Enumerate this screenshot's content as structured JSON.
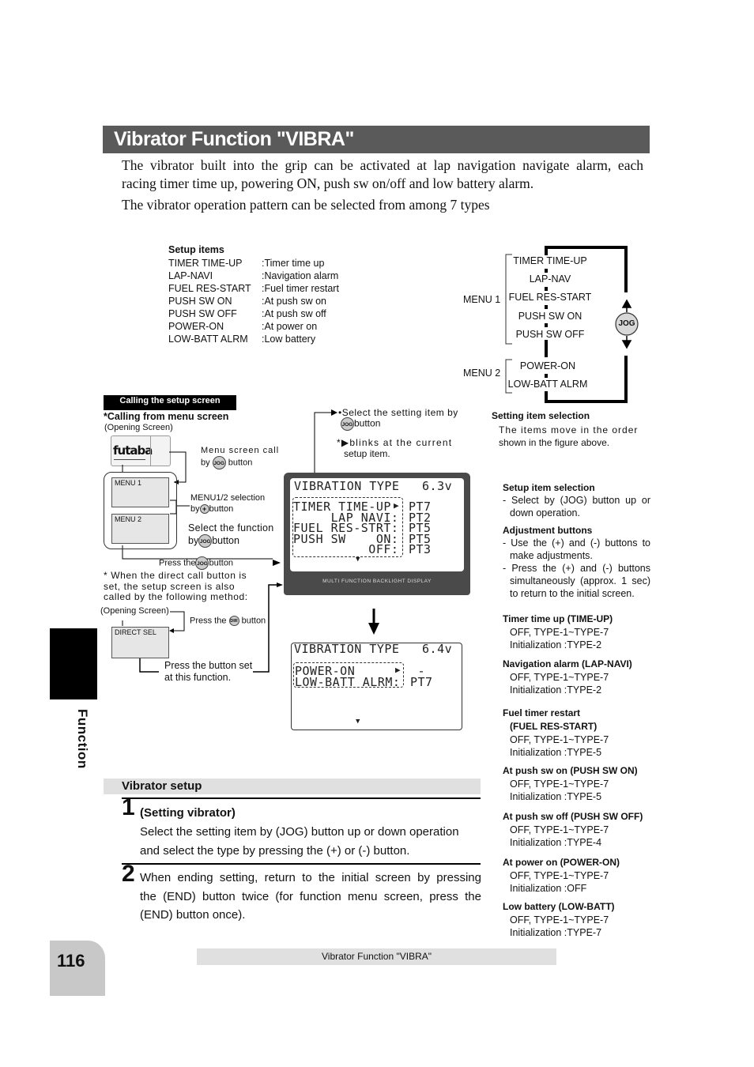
{
  "title": "Vibrator Function  \"VIBRA\"",
  "intro": {
    "p1_line1": "The vibrator built into the grip can be activated at lap navigation navigate alarm, each",
    "p1_line2": "racing timer time up, powering ON, push sw on/off and low battery alarm.",
    "p2": "The vibrator operation pattern can be selected from among 7 types"
  },
  "setup_items": {
    "heading": "Setup items",
    "rows": [
      {
        "key": "TIMER TIME-UP",
        "desc": ":Timer time up"
      },
      {
        "key": "LAP-NAVI",
        "desc": ":Navigation alarm"
      },
      {
        "key": "FUEL RES-START",
        "desc": ":Fuel timer restart"
      },
      {
        "key": "PUSH SW ON",
        "desc": ":At push sw on"
      },
      {
        "key": "PUSH SW OFF",
        "desc": ":At push sw off"
      },
      {
        "key": "POWER-ON",
        "desc": ":At power on"
      },
      {
        "key": "LOW-BATT ALRM",
        "desc": ":Low battery"
      }
    ]
  },
  "menu_diagram": {
    "menu1_label": "MENU 1",
    "menu2_label": "MENU 2",
    "menu1_items": [
      "TIMER TIME-UP",
      "LAP-NAV",
      "FUEL RES-START",
      "PUSH SW ON",
      "PUSH SW OFF"
    ],
    "menu2_items": [
      "POWER-ON",
      "LOW-BATT ALRM"
    ],
    "jog_label": "JOG"
  },
  "calling": {
    "tag": "Calling the setup screen",
    "from_menu": "*Calling from menu screen",
    "opening_screen": "(Opening Screen)",
    "menu_call_line1": "Menu screen call",
    "menu_call_by": "by",
    "menu_call_btn": "button",
    "menu1": "MENU 1",
    "menu2": "MENU 2",
    "menu_sel_line1": "MENU1/2 selection",
    "menu_sel_by": "by",
    "menu_sel_btn": "button",
    "select_func_line1": "Select the function",
    "select_func_by": "by",
    "select_func_btn": "button",
    "press_the": "Press the",
    "press_btn": "button",
    "direct_note": "* When the direct call button is set, the setup screen is also called by the following method:",
    "opening_screen2": "(Opening Screen)",
    "press_dir_the": "Press the",
    "press_dir_btn": "button",
    "direct_sel": "DIRECT SEL",
    "press_set_line1": "Press the button set",
    "press_set_line2": "at this function.",
    "jog": "JOG",
    "plus": "+",
    "dir": "DIR",
    "logo": "futaba"
  },
  "select_note": {
    "line1": "•Select the setting item by",
    "btn": "button",
    "blink_pre": "*",
    "blink_text": "blinks at the current",
    "blink_line2": "setup item."
  },
  "lcd1": {
    "header": "VIBRATION TYPE   6.3v",
    "rows": [
      {
        "label": "TIMER TIME-UP",
        "value": "PT7"
      },
      {
        "label": "     LAP NAVI:",
        "value": "PT2"
      },
      {
        "label": "FUEL RES-STRT:",
        "value": "PT5"
      },
      {
        "label": "PUSH SW    ON:",
        "value": "PT5"
      },
      {
        "label": "          OFF:",
        "value": "PT3"
      }
    ],
    "footer": "MULTI FUNCTION BACKLIGHT DISPLAY"
  },
  "lcd2": {
    "header": "VIBRATION TYPE   6.4v",
    "rows": [
      {
        "label": "POWER-ON      ",
        "value": " -"
      },
      {
        "label": "LOW-BATT ALRM:",
        "value": "PT7"
      }
    ]
  },
  "right_notes": {
    "setting_sel_head": "Setting item selection",
    "setting_sel_text1": "The items move in the order",
    "setting_sel_text2": "shown in the figure above.",
    "setup_sel_head": "Setup item selection",
    "setup_sel_text": "- Select by (JOG) button up or down operation.",
    "adj_head": "Adjustment buttons",
    "adj_text1": "- Use the (+) and (-) buttons to make adjustments.",
    "adj_text2": "- Press the (+) and (-) buttons simultaneously (approx. 1 sec) to return to the initial screen.",
    "params": [
      {
        "head": "Timer time up (TIME-UP)",
        "range": "OFF, TYPE-1~TYPE-7",
        "init": "Initialization :TYPE-2"
      },
      {
        "head": "Navigation  alarm (LAP-NAVI)",
        "range": "OFF, TYPE-1~TYPE-7",
        "init": "Initialization :TYPE-2"
      },
      {
        "head": "Fuel timer restart",
        "head2": "(FUEL RES-START)",
        "range": "OFF, TYPE-1~TYPE-7",
        "init": "Initialization :TYPE-5"
      },
      {
        "head": "At push sw on (PUSH SW ON)",
        "range": "OFF, TYPE-1~TYPE-7",
        "init": "Initialization :TYPE-5"
      },
      {
        "head": "At push sw off (PUSH SW OFF)",
        "range": "OFF, TYPE-1~TYPE-7",
        "init": "Initialization :TYPE-4"
      },
      {
        "head": "At power on (POWER-ON)",
        "range": "OFF, TYPE-1~TYPE-7",
        "init": "Initialization :OFF"
      },
      {
        "head": "Low battery (LOW-BATT)",
        "range": "OFF, TYPE-1~TYPE-7",
        "init": "Initialization :TYPE-7"
      }
    ]
  },
  "vibrator_setup": {
    "heading": "Vibrator setup",
    "step1_num": "1",
    "step1_title": "(Setting vibrator)",
    "step1_line1": "Select the setting item by (JOG) button up or down operation",
    "step1_line2": "and select the type by pressing the (+) or (-) button.",
    "step2_num": "2",
    "step2_line1": "When ending setting, return to the initial screen by pressing",
    "step2_line2": "the (END) button twice (for function menu screen, press the",
    "step2_line3": "(END) button once)."
  },
  "side_label": "Function",
  "page_number": "116",
  "footer_title": "Vibrator Function  \"VIBRA\""
}
